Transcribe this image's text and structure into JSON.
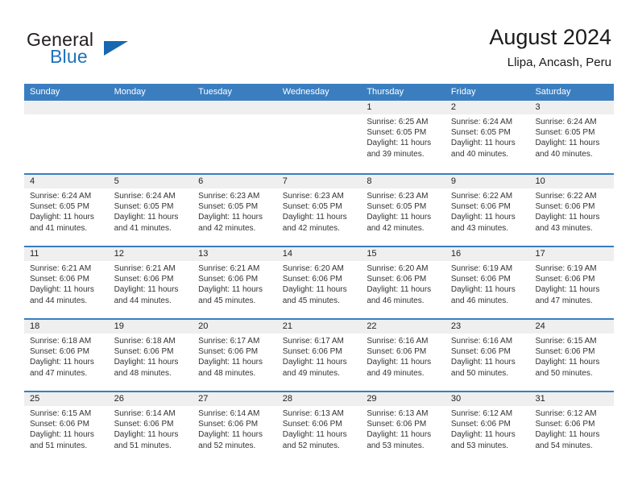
{
  "logo": {
    "word_top": "General",
    "word_bottom": "Blue",
    "triangle_color": "#1668b0"
  },
  "header": {
    "title": "August 2024",
    "subtitle": "Llipa, Ancash, Peru"
  },
  "theme": {
    "header_blue": "#3a7ec0",
    "date_band_gray": "#efefef",
    "text_color": "#333333"
  },
  "weekday_headers": [
    "Sunday",
    "Monday",
    "Tuesday",
    "Wednesday",
    "Thursday",
    "Friday",
    "Saturday"
  ],
  "labels": {
    "sunrise_prefix": "Sunrise:",
    "sunset_prefix": "Sunset:",
    "daylight_prefix": "Daylight:"
  },
  "weeks": [
    [
      {
        "day": "",
        "empty": true,
        "sunrise": "",
        "sunset": "",
        "daylight_line1": "",
        "daylight_line2": ""
      },
      {
        "day": "",
        "empty": true,
        "sunrise": "",
        "sunset": "",
        "daylight_line1": "",
        "daylight_line2": ""
      },
      {
        "day": "",
        "empty": true,
        "sunrise": "",
        "sunset": "",
        "daylight_line1": "",
        "daylight_line2": ""
      },
      {
        "day": "",
        "empty": true,
        "sunrise": "",
        "sunset": "",
        "daylight_line1": "",
        "daylight_line2": ""
      },
      {
        "day": "1",
        "empty": false,
        "sunrise": "Sunrise: 6:25 AM",
        "sunset": "Sunset: 6:05 PM",
        "daylight_line1": "Daylight: 11 hours",
        "daylight_line2": "and 39 minutes."
      },
      {
        "day": "2",
        "empty": false,
        "sunrise": "Sunrise: 6:24 AM",
        "sunset": "Sunset: 6:05 PM",
        "daylight_line1": "Daylight: 11 hours",
        "daylight_line2": "and 40 minutes."
      },
      {
        "day": "3",
        "empty": false,
        "sunrise": "Sunrise: 6:24 AM",
        "sunset": "Sunset: 6:05 PM",
        "daylight_line1": "Daylight: 11 hours",
        "daylight_line2": "and 40 minutes."
      }
    ],
    [
      {
        "day": "4",
        "empty": false,
        "sunrise": "Sunrise: 6:24 AM",
        "sunset": "Sunset: 6:05 PM",
        "daylight_line1": "Daylight: 11 hours",
        "daylight_line2": "and 41 minutes."
      },
      {
        "day": "5",
        "empty": false,
        "sunrise": "Sunrise: 6:24 AM",
        "sunset": "Sunset: 6:05 PM",
        "daylight_line1": "Daylight: 11 hours",
        "daylight_line2": "and 41 minutes."
      },
      {
        "day": "6",
        "empty": false,
        "sunrise": "Sunrise: 6:23 AM",
        "sunset": "Sunset: 6:05 PM",
        "daylight_line1": "Daylight: 11 hours",
        "daylight_line2": "and 42 minutes."
      },
      {
        "day": "7",
        "empty": false,
        "sunrise": "Sunrise: 6:23 AM",
        "sunset": "Sunset: 6:05 PM",
        "daylight_line1": "Daylight: 11 hours",
        "daylight_line2": "and 42 minutes."
      },
      {
        "day": "8",
        "empty": false,
        "sunrise": "Sunrise: 6:23 AM",
        "sunset": "Sunset: 6:05 PM",
        "daylight_line1": "Daylight: 11 hours",
        "daylight_line2": "and 42 minutes."
      },
      {
        "day": "9",
        "empty": false,
        "sunrise": "Sunrise: 6:22 AM",
        "sunset": "Sunset: 6:06 PM",
        "daylight_line1": "Daylight: 11 hours",
        "daylight_line2": "and 43 minutes."
      },
      {
        "day": "10",
        "empty": false,
        "sunrise": "Sunrise: 6:22 AM",
        "sunset": "Sunset: 6:06 PM",
        "daylight_line1": "Daylight: 11 hours",
        "daylight_line2": "and 43 minutes."
      }
    ],
    [
      {
        "day": "11",
        "empty": false,
        "sunrise": "Sunrise: 6:21 AM",
        "sunset": "Sunset: 6:06 PM",
        "daylight_line1": "Daylight: 11 hours",
        "daylight_line2": "and 44 minutes."
      },
      {
        "day": "12",
        "empty": false,
        "sunrise": "Sunrise: 6:21 AM",
        "sunset": "Sunset: 6:06 PM",
        "daylight_line1": "Daylight: 11 hours",
        "daylight_line2": "and 44 minutes."
      },
      {
        "day": "13",
        "empty": false,
        "sunrise": "Sunrise: 6:21 AM",
        "sunset": "Sunset: 6:06 PM",
        "daylight_line1": "Daylight: 11 hours",
        "daylight_line2": "and 45 minutes."
      },
      {
        "day": "14",
        "empty": false,
        "sunrise": "Sunrise: 6:20 AM",
        "sunset": "Sunset: 6:06 PM",
        "daylight_line1": "Daylight: 11 hours",
        "daylight_line2": "and 45 minutes."
      },
      {
        "day": "15",
        "empty": false,
        "sunrise": "Sunrise: 6:20 AM",
        "sunset": "Sunset: 6:06 PM",
        "daylight_line1": "Daylight: 11 hours",
        "daylight_line2": "and 46 minutes."
      },
      {
        "day": "16",
        "empty": false,
        "sunrise": "Sunrise: 6:19 AM",
        "sunset": "Sunset: 6:06 PM",
        "daylight_line1": "Daylight: 11 hours",
        "daylight_line2": "and 46 minutes."
      },
      {
        "day": "17",
        "empty": false,
        "sunrise": "Sunrise: 6:19 AM",
        "sunset": "Sunset: 6:06 PM",
        "daylight_line1": "Daylight: 11 hours",
        "daylight_line2": "and 47 minutes."
      }
    ],
    [
      {
        "day": "18",
        "empty": false,
        "sunrise": "Sunrise: 6:18 AM",
        "sunset": "Sunset: 6:06 PM",
        "daylight_line1": "Daylight: 11 hours",
        "daylight_line2": "and 47 minutes."
      },
      {
        "day": "19",
        "empty": false,
        "sunrise": "Sunrise: 6:18 AM",
        "sunset": "Sunset: 6:06 PM",
        "daylight_line1": "Daylight: 11 hours",
        "daylight_line2": "and 48 minutes."
      },
      {
        "day": "20",
        "empty": false,
        "sunrise": "Sunrise: 6:17 AM",
        "sunset": "Sunset: 6:06 PM",
        "daylight_line1": "Daylight: 11 hours",
        "daylight_line2": "and 48 minutes."
      },
      {
        "day": "21",
        "empty": false,
        "sunrise": "Sunrise: 6:17 AM",
        "sunset": "Sunset: 6:06 PM",
        "daylight_line1": "Daylight: 11 hours",
        "daylight_line2": "and 49 minutes."
      },
      {
        "day": "22",
        "empty": false,
        "sunrise": "Sunrise: 6:16 AM",
        "sunset": "Sunset: 6:06 PM",
        "daylight_line1": "Daylight: 11 hours",
        "daylight_line2": "and 49 minutes."
      },
      {
        "day": "23",
        "empty": false,
        "sunrise": "Sunrise: 6:16 AM",
        "sunset": "Sunset: 6:06 PM",
        "daylight_line1": "Daylight: 11 hours",
        "daylight_line2": "and 50 minutes."
      },
      {
        "day": "24",
        "empty": false,
        "sunrise": "Sunrise: 6:15 AM",
        "sunset": "Sunset: 6:06 PM",
        "daylight_line1": "Daylight: 11 hours",
        "daylight_line2": "and 50 minutes."
      }
    ],
    [
      {
        "day": "25",
        "empty": false,
        "sunrise": "Sunrise: 6:15 AM",
        "sunset": "Sunset: 6:06 PM",
        "daylight_line1": "Daylight: 11 hours",
        "daylight_line2": "and 51 minutes."
      },
      {
        "day": "26",
        "empty": false,
        "sunrise": "Sunrise: 6:14 AM",
        "sunset": "Sunset: 6:06 PM",
        "daylight_line1": "Daylight: 11 hours",
        "daylight_line2": "and 51 minutes."
      },
      {
        "day": "27",
        "empty": false,
        "sunrise": "Sunrise: 6:14 AM",
        "sunset": "Sunset: 6:06 PM",
        "daylight_line1": "Daylight: 11 hours",
        "daylight_line2": "and 52 minutes."
      },
      {
        "day": "28",
        "empty": false,
        "sunrise": "Sunrise: 6:13 AM",
        "sunset": "Sunset: 6:06 PM",
        "daylight_line1": "Daylight: 11 hours",
        "daylight_line2": "and 52 minutes."
      },
      {
        "day": "29",
        "empty": false,
        "sunrise": "Sunrise: 6:13 AM",
        "sunset": "Sunset: 6:06 PM",
        "daylight_line1": "Daylight: 11 hours",
        "daylight_line2": "and 53 minutes."
      },
      {
        "day": "30",
        "empty": false,
        "sunrise": "Sunrise: 6:12 AM",
        "sunset": "Sunset: 6:06 PM",
        "daylight_line1": "Daylight: 11 hours",
        "daylight_line2": "and 53 minutes."
      },
      {
        "day": "31",
        "empty": false,
        "sunrise": "Sunrise: 6:12 AM",
        "sunset": "Sunset: 6:06 PM",
        "daylight_line1": "Daylight: 11 hours",
        "daylight_line2": "and 54 minutes."
      }
    ]
  ]
}
